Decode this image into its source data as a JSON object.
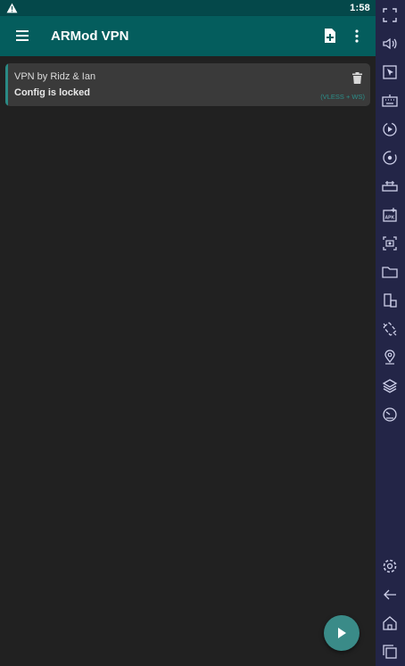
{
  "status_bar": {
    "time": "1:58",
    "icons": [
      "warning-icon"
    ]
  },
  "app_bar": {
    "title": "ARMod VPN",
    "icons": [
      "menu-icon",
      "add-file-icon",
      "more-vert-icon"
    ]
  },
  "configs": [
    {
      "name": "VPN by Ridz & Ian",
      "status": "Config is locked",
      "protocol": "(VLESS + WS)"
    }
  ],
  "fab": {
    "icon": "play-icon"
  },
  "emulator_toolbar": {
    "icons": [
      "fullscreen-icon",
      "volume-icon",
      "cursor-icon",
      "keyboard-icon",
      "record-icon",
      "rotate-icon",
      "gamepad-icon",
      "apk-icon",
      "screenshot-icon",
      "folder-icon",
      "multi-window-icon",
      "shake-icon",
      "location-icon",
      "layers-icon",
      "speed-icon",
      "settings-icon",
      "back-icon",
      "home-icon",
      "recents-icon"
    ]
  },
  "colors": {
    "accent": "#045d5d",
    "status_bar": "#04484a",
    "fab": "#3a8b88",
    "sidebar": "#232547",
    "background": "#212121"
  }
}
